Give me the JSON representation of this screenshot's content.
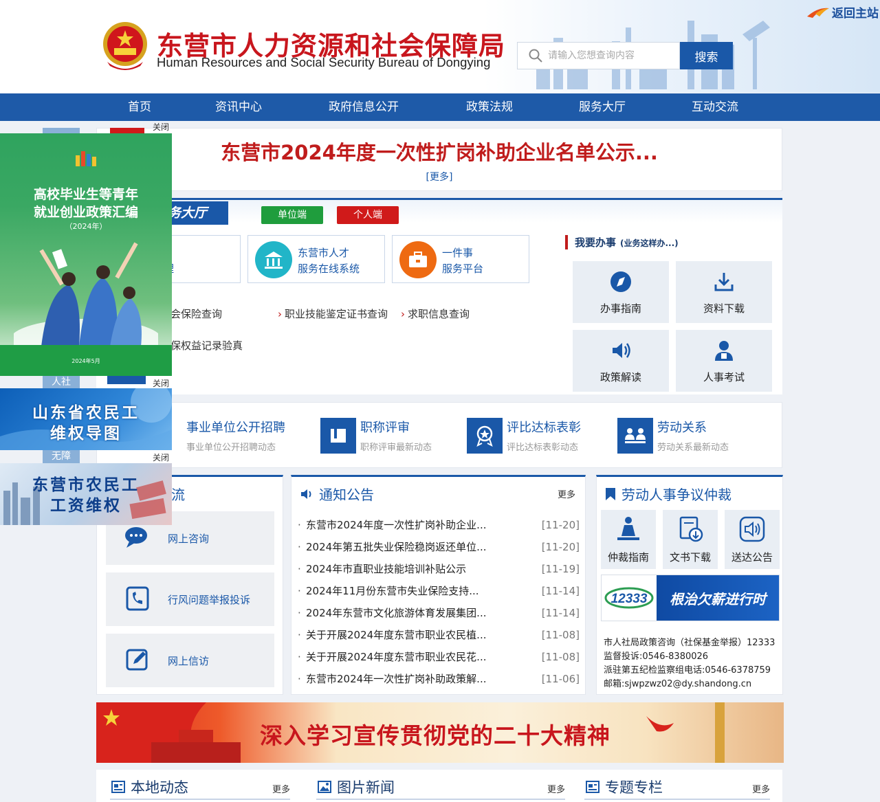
{
  "header": {
    "title": "东营市人力资源和社会保障局",
    "subtitle": "Human Resources and Social Security Bureau of Dongying",
    "back_home": "返回主站",
    "search_placeholder": "请输入您想查询内容",
    "search_button": "搜索"
  },
  "nav": [
    "首页",
    "资讯中心",
    "政府信息公开",
    "政策法规",
    "服务大厅",
    "互动交流"
  ],
  "headline": {
    "title": "东营市2024年度一次性扩岗补助企业名单公示...",
    "more": "[更多]"
  },
  "service": {
    "title": "务大厅",
    "tag_unit": "单位端",
    "tag_personal": "个人端",
    "card1": {
      "line1": "、",
      "line2": "办理"
    },
    "card2": {
      "line1": "东营市人才",
      "line2": "服务在线系统"
    },
    "card3": {
      "line1": "一件事",
      "line2": "服务平台"
    },
    "links": [
      "会保险查询",
      "职业技能鉴定证书查询",
      "求职信息查询",
      "保权益记录验真"
    ],
    "wybs_title": "我要办事",
    "wybs_sub": "(业务这样办...)",
    "tiles": [
      "办事指南",
      "资料下载",
      "政策解读",
      "人事考试"
    ]
  },
  "columns": [
    {
      "title": "事业单位公开招聘",
      "sub": "事业单位公开招聘动态"
    },
    {
      "title": "职称评审",
      "sub": "职称评审最新动态"
    },
    {
      "title": "评比达标表彰",
      "sub": "评比达标表彰动态"
    },
    {
      "title": "劳动关系",
      "sub": "劳动关系最新动态"
    }
  ],
  "interact": {
    "title": "流",
    "buttons": [
      "网上咨询",
      "行风问题举报投诉",
      "网上信访"
    ]
  },
  "notice": {
    "title": "通知公告",
    "more": "更多",
    "items": [
      {
        "text": "东营市2024年度一次性扩岗补助企业...",
        "date": "[11-20]"
      },
      {
        "text": "2024年第五批失业保险稳岗返还单位...",
        "date": "[11-20]"
      },
      {
        "text": "2024年市直职业技能培训补贴公示",
        "date": "[11-19]"
      },
      {
        "text": "2024年11月份东营市失业保险支持...",
        "date": "[11-14]"
      },
      {
        "text": "2024年东营市文化旅游体育发展集团...",
        "date": "[11-14]"
      },
      {
        "text": "关于开展2024年度东营市职业农民植...",
        "date": "[11-08]"
      },
      {
        "text": "关于开展2024年度东营市职业农民花...",
        "date": "[11-08]"
      },
      {
        "text": "东营市2024年一次性扩岗补助政策解...",
        "date": "[11-06]"
      }
    ]
  },
  "arbitration": {
    "title": "劳动人事争议仲裁",
    "tiles": [
      "仲裁指南",
      "文书下载",
      "送达公告"
    ],
    "banner_logo": "12333",
    "banner_text": "根治欠薪进行时",
    "contacts": [
      "市人社局政策咨询（社保基金举报）12333",
      "监督投诉:0546-8380026",
      "派驻第五纪检监察组电话:0546-6378759",
      "邮箱:sjwpzwz02@dy.shandong.cn"
    ]
  },
  "red_banner": "深入学习宣传贯彻党的二十大精神",
  "bottom_sections": [
    {
      "title": "本地动态",
      "more": "更多"
    },
    {
      "title": "图片新闻",
      "more": "更多"
    },
    {
      "title": "专题专栏",
      "more": "更多"
    }
  ],
  "float_ads": {
    "close": "关闭",
    "ad1_line1": "高校毕业生等青年",
    "ad1_line2": "就业创业政策汇编",
    "ad1_year": "（2024年）",
    "ad1_date": "2024年5月",
    "ad2_line1": "山东省农民工",
    "ad2_line2": "维权导图",
    "ad3_line1": "东营市农民工",
    "ad3_line2": "工资维权",
    "peek_text1": "人社",
    "peek_text2": "无障"
  },
  "colors": {
    "brand_blue": "#1e5aa8",
    "brand_red": "#c8161d",
    "green": "#1f9d3d"
  }
}
